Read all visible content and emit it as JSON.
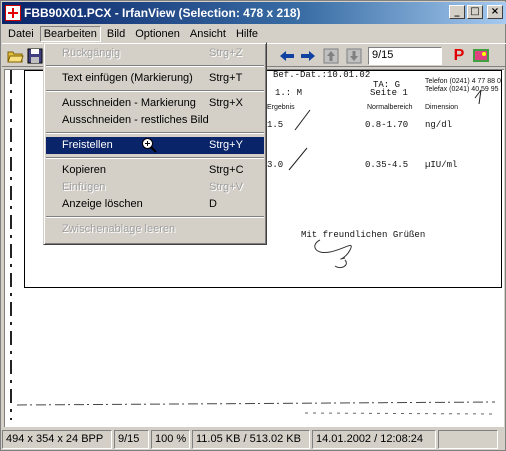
{
  "window": {
    "title": "FBB90X01.PCX - IrfanView (Selection: 478 x 218)"
  },
  "title_buttons": {
    "minimize": "_",
    "maximize": "□",
    "close": "×"
  },
  "menubar": [
    "Datei",
    "Bearbeiten",
    "Bild",
    "Optionen",
    "Ansicht",
    "Hilfe"
  ],
  "toolbar": {
    "page_value": "9/15",
    "icons": [
      "open-folder-icon",
      "save-icon",
      "film-icon",
      "back-arrow-icon",
      "forward-arrow-icon",
      "up-icon",
      "down-icon",
      "paint-icon",
      "slideshow-icon"
    ]
  },
  "edit_menu": {
    "items": [
      {
        "label": "Rückgängig",
        "shortcut": "Strg+Z",
        "disabled": true
      },
      {
        "sep": true
      },
      {
        "label": "Text einfügen (Markierung)",
        "shortcut": "Strg+T"
      },
      {
        "sep": true
      },
      {
        "label": "Ausschneiden - Markierung",
        "shortcut": "Strg+X"
      },
      {
        "label": "Ausschneiden - restliches Bild",
        "shortcut": ""
      },
      {
        "sep": true
      },
      {
        "label": "Freistellen",
        "shortcut": "Strg+Y",
        "highlight": true
      },
      {
        "sep": true
      },
      {
        "label": "Kopieren",
        "shortcut": "Strg+C"
      },
      {
        "label": "Einfügen",
        "shortcut": "Strg+V",
        "disabled": true
      },
      {
        "label": "Anzeige löschen",
        "shortcut": "D"
      },
      {
        "sep": true
      },
      {
        "label": "Zwischenablage leeren",
        "shortcut": "",
        "disabled": true
      }
    ]
  },
  "document": {
    "header_left": "1.: M",
    "header_date": "Bef.-Dat.:10.01.02",
    "header_page": "Seite  1",
    "header_ta": "TA: G",
    "phone": "Telefon (0241) 4 77 88 0",
    "fax": "Telefax (0241) 40 59 95",
    "col_result": "Ergebnis",
    "col_normal": "Normalbereich",
    "col_dim": "Dimension",
    "row1_value": "1.5",
    "row1_range": "0.8-1.70",
    "row1_unit": "ng/dl",
    "row2_value": "3.0",
    "row2_range": "0.35-4.5",
    "row2_unit": "µIU/ml",
    "greeting": "Mit freundlichen Grüßen"
  },
  "status": {
    "dimensions": "494 x 354 x 24 BPP",
    "page": "9/15",
    "zoom": "100 %",
    "size": "11.05 KB / 513.02 KB",
    "datetime": "14.01.2002 / 12:08:24"
  }
}
